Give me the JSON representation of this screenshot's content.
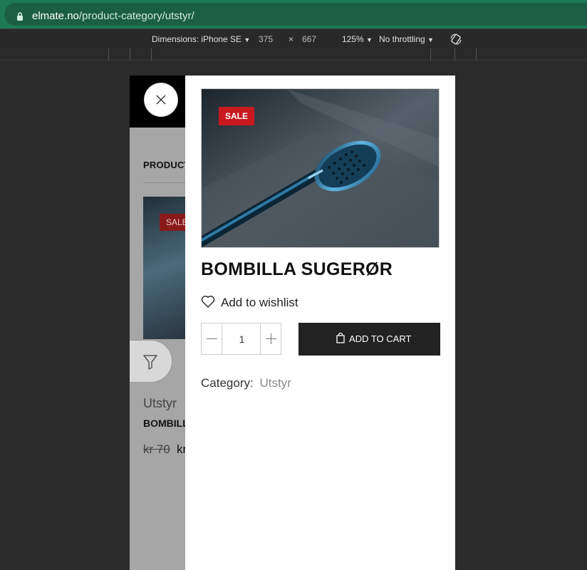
{
  "browser": {
    "url_domain": "elmate.no",
    "url_path": "/product-category/utstyr/"
  },
  "devtools": {
    "dimensions_label": "Dimensions: iPhone SE",
    "width": "375",
    "times": "×",
    "height": "667",
    "zoom": "125%",
    "throttling": "No throttling"
  },
  "background_page": {
    "section_title": "PRODUCT C",
    "sale_badge": "SALE",
    "category": "Utstyr",
    "product_name": "BOMBILLA",
    "old_price": "kr 70",
    "new_price": "kr"
  },
  "quick_view": {
    "sale_badge": "SALE",
    "product_name": "BOMBILLA SUGERØR",
    "wishlist_label": "Add to wishlist",
    "quantity": "1",
    "add_to_cart_label": "ADD TO CART",
    "category_label": "Category:",
    "category_value": "Utstyr"
  },
  "colors": {
    "sale": "#c8191f",
    "button": "#222222",
    "address_bar": "#1e7a55"
  },
  "icons": [
    "lock-icon",
    "chevron-down-icon",
    "rotate-icon",
    "hamburger-icon",
    "close-icon",
    "filter-icon",
    "heart-icon",
    "minus-icon",
    "plus-icon",
    "shopping-bag-icon"
  ]
}
